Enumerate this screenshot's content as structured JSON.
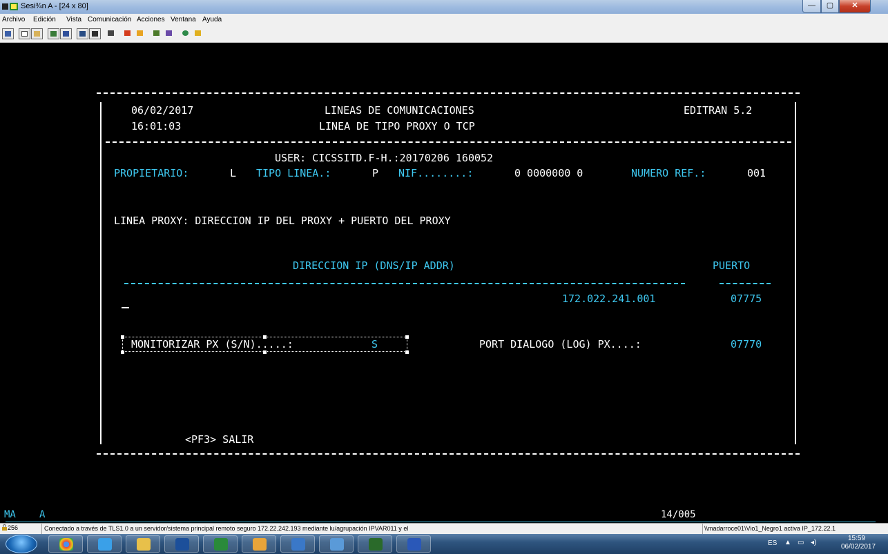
{
  "window": {
    "title": "Sesi¾n A - [24 x 80]",
    "min_glyph": "—",
    "max_glyph": "▢",
    "close_glyph": "✕"
  },
  "menu": [
    "Archivo",
    "Edición",
    "Vista",
    "Comunicación",
    "Acciones",
    "Ventana",
    "Ayuda"
  ],
  "toolbar_icons": [
    "display-icon",
    "copy-icon",
    "paste-icon",
    "send-icon",
    "receive-icon",
    "macro-icon",
    "macro2-icon",
    "keyboard-icon",
    "transfer-send-icon",
    "transfer-recv-icon",
    "network-icon",
    "network2-icon",
    "color-palette-icon",
    "edit-pencil-icon"
  ],
  "screen": {
    "date": "06/02/2017",
    "time": "16:01:03",
    "title": "LINEAS DE COMUNICACIONES",
    "subtitle": "LINEA DE TIPO PROXY O TCP",
    "product": "EDITRAN 5.2",
    "user_line": "USER: CICSSITD.F-H.:20170206 160052",
    "info_prefix": "PROPIETARIO: ",
    "owner": "L",
    "tipo_label": "TIPO LINEA.: ",
    "tipo": "P",
    "nif_label": "NIF........: ",
    "nif": "0 0000000 0",
    "ref_label": "NUMERO REF.: ",
    "ref": "001",
    "proxy_desc": "LINEA PROXY: DIRECCION IP DEL PROXY + PUERTO DEL PROXY",
    "col_ip": "DIRECCION IP (DNS/IP ADDR)",
    "col_port": "PUERTO",
    "ip_value": "172.022.241.001",
    "port_value": "07775",
    "monitor_label": "MONITORIZAR PX (S/N).....: ",
    "monitor_value": "S",
    "log_label": "PORT DIALOGO (LOG) PX....: ",
    "log_value": "07770",
    "exit": "<PF3> SALIR"
  },
  "oia": {
    "mode": "MA",
    "session": "A",
    "cursor_pos": "14/005"
  },
  "status": {
    "number": "256",
    "message": "Conectado a través de TLS1.0 a un servidor/sistema principal remoto seguro 172.22.242.193 mediante lu/agrupación IPVAR011 y el",
    "path": "\\\\madarroce01\\Vio1_Negro1 activa IP_172.22.1"
  },
  "taskbar": {
    "apps": [
      "chrome-icon",
      "ie-icon",
      "explorer-icon",
      "powershell-icon",
      "presentation-icon",
      "outlook-icon",
      "lync-icon",
      "network-share-icon",
      "emulator-icon",
      "word-icon"
    ],
    "lang": "ES",
    "clock_time": "15:59",
    "clock_date": "06/02/2017"
  },
  "colors": {
    "terminal_bg": "#000000",
    "terminal_white": "#ffffff",
    "terminal_cyan": "#3ec8f0"
  }
}
